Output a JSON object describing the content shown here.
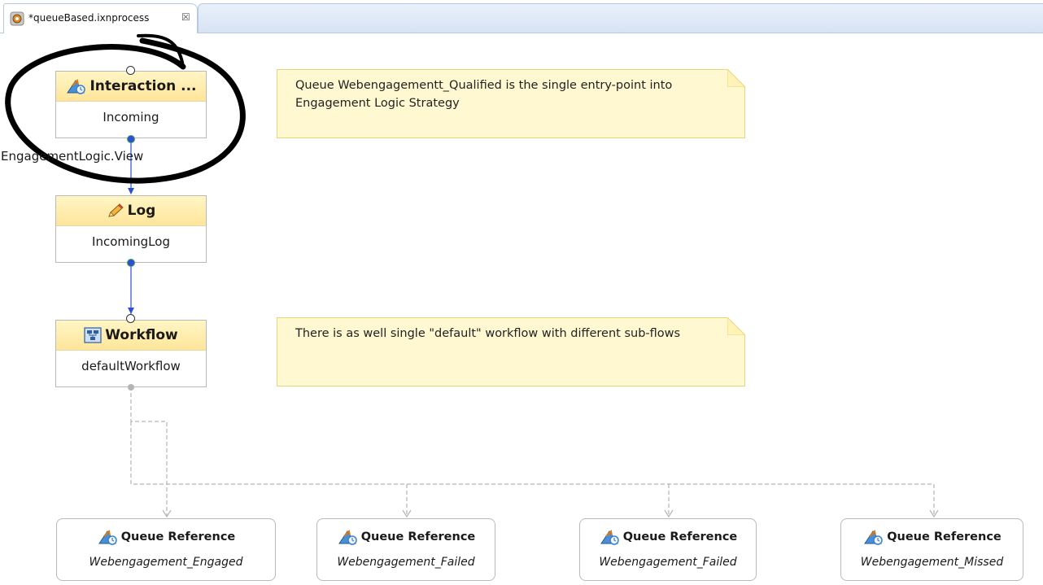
{
  "editor": {
    "tab_title": "*queueBased.ixnprocess",
    "close_glyph": "☒",
    "tab_icon": "process-file-icon"
  },
  "nodes": {
    "interaction": {
      "title": "Interaction ...",
      "name": "Incoming",
      "icon": "interaction-queue-icon"
    },
    "log": {
      "title": "Log",
      "name": "IncomingLog",
      "icon": "pencil-icon"
    },
    "workflow": {
      "title": "Workflow",
      "name": "defaultWorkflow",
      "icon": "workflow-icon"
    }
  },
  "connection_label": "EngagementLogic.View",
  "notes": [
    {
      "text": "Queue Webengagementt_Qualified is the single entry-point into Engagement Logic Strategy"
    },
    {
      "text": "There is as well single \"default\" workflow with different sub-flows"
    }
  ],
  "queue_references": [
    {
      "label": "Queue Reference",
      "name": "Webengagement_Engaged"
    },
    {
      "label": "Queue Reference",
      "name": "Webengagement_Failed"
    },
    {
      "label": "Queue Reference",
      "name": "Webengagement_Failed"
    },
    {
      "label": "Queue Reference",
      "name": "Webengagement_Missed"
    }
  ],
  "colors": {
    "node_header": "#ffe59a",
    "note_fill": "#fff8d1",
    "connector_blue": "#2a4fd8",
    "connector_dashed": "#b5b5b5",
    "highlight_ring": "#000000"
  }
}
